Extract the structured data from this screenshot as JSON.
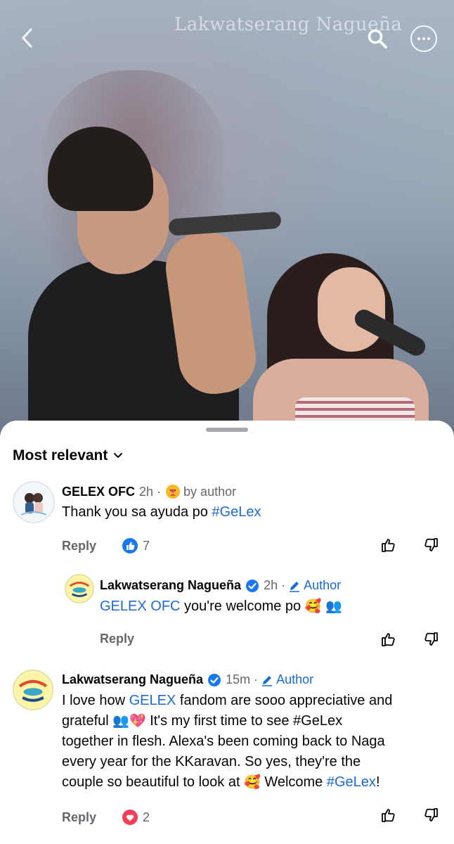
{
  "header": {
    "watermark": "Lakwatserang Nagueña"
  },
  "sheet": {
    "sort_label": "Most relevant"
  },
  "comments": [
    {
      "author": "GELEX OFC",
      "time": "2h ·",
      "badge": "by author",
      "text": "Thank you sa ayuda po",
      "hashtag": "#GeLex",
      "reply_label": "Reply",
      "reaction_count": "7",
      "reaction_type": "like"
    },
    {
      "author": "Lakwatserang Nagueña",
      "time": "2h ·",
      "badge": "Author",
      "mention": "GELEX OFC",
      "text": "you're welcome po",
      "reply_label": "Reply"
    },
    {
      "author": "Lakwatserang Nagueña",
      "time": "15m ·",
      "badge": "Author",
      "text_1": "I love how",
      "mention": "GELEX",
      "text_2": "fandom are sooo appreciative and",
      "text_3": "grateful",
      "text_4": "It's my first time to see #GeLex",
      "text_5": "together in flesh. Alexa's been coming back to Naga",
      "text_6": "every year for the KKaravan. So yes, they're the",
      "text_7": "couple so beautiful to look at",
      "text_8": "Welcome",
      "hashtag": "#GeLex",
      "text_end": "!",
      "reply_label": "Reply",
      "reaction_count": "2",
      "reaction_type": "love"
    }
  ],
  "colors": {
    "link": "#1b6ad9",
    "meta": "#65676b",
    "like": "#1877f2",
    "love": "#f33e58"
  },
  "icons": [
    "back-icon",
    "search-icon",
    "more-icon",
    "chevron-down-icon",
    "like-icon",
    "love-icon",
    "verified-icon",
    "pencil-icon",
    "thumbs-up-icon",
    "thumbs-down-icon"
  ]
}
